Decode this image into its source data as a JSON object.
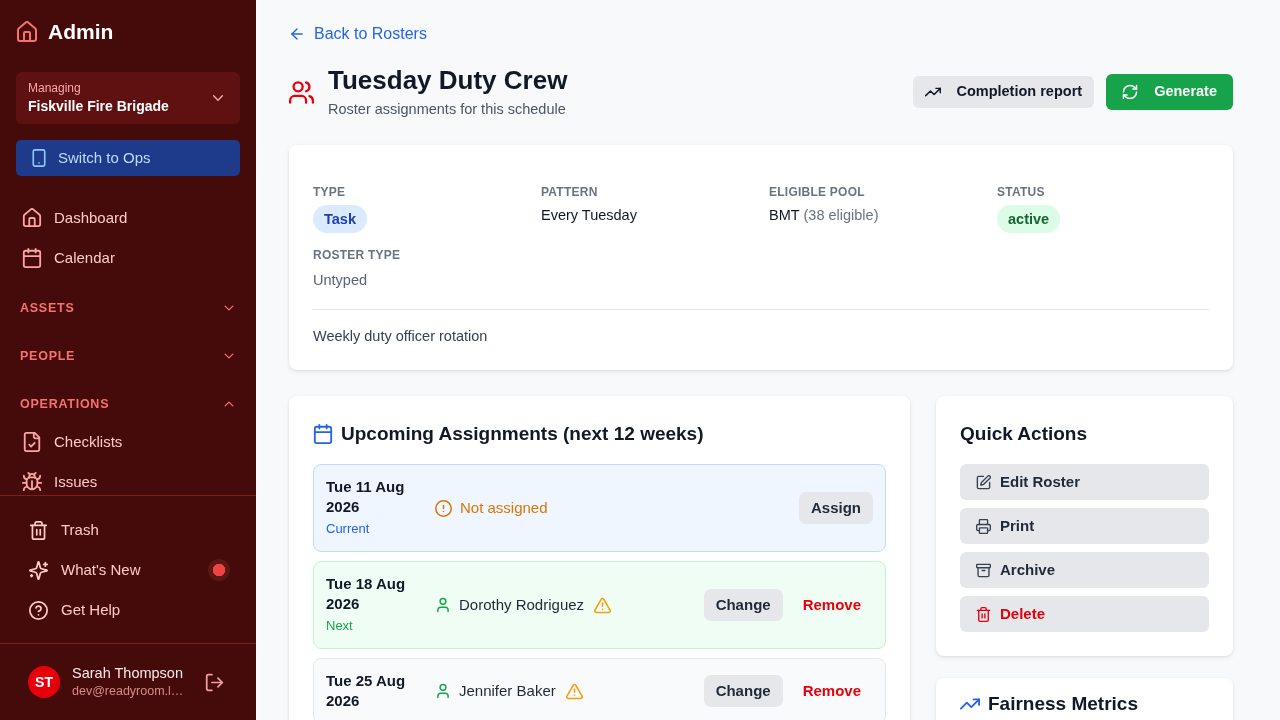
{
  "sidebar": {
    "brand": "Admin",
    "org_switcher": {
      "caption": "Managing",
      "name": "Fiskville Fire Brigade"
    },
    "mode_button": "Switch to Ops",
    "nav": [
      {
        "kind": "link",
        "label": "Dashboard",
        "selected": false
      },
      {
        "kind": "link",
        "label": "Calendar",
        "selected": false
      },
      {
        "kind": "section",
        "label": "ASSETS",
        "expanded": false
      },
      {
        "kind": "section",
        "label": "PEOPLE",
        "expanded": false
      },
      {
        "kind": "section",
        "label": "OPERATIONS",
        "expanded": true,
        "children": [
          {
            "kind": "link",
            "label": "Checklists",
            "selected": false
          },
          {
            "kind": "link",
            "label": "Issues",
            "selected": false
          }
        ]
      }
    ],
    "footer_links": [
      {
        "label": "Trash",
        "unread": false
      },
      {
        "label": "What's New",
        "unread": true
      },
      {
        "label": "Get Help",
        "unread": false
      }
    ],
    "user": {
      "initials": "ST",
      "name": "Sarah Thompson",
      "email": "dev@readyroom.l…"
    }
  },
  "back_link": "Back to Rosters",
  "header": {
    "title": "Tuesday Duty Crew",
    "subtitle": "Roster assignments for this schedule",
    "actions": [
      {
        "label": "Completion report",
        "kind": "secondary"
      },
      {
        "label": "Generate",
        "kind": "primary"
      }
    ]
  },
  "details": {
    "fields": [
      {
        "label": "TYPE",
        "kind": "badge",
        "value": "Task",
        "color": "#dbeafe"
      },
      {
        "label": "PATTERN",
        "kind": "text",
        "value": "Every Tuesday"
      },
      {
        "label": "ELIGIBLE POOL",
        "kind": "text",
        "value": "BMT",
        "note": "(38 eligible)"
      },
      {
        "label": "STATUS",
        "kind": "badge",
        "value": "active",
        "color": "#dcfce7"
      },
      {
        "label": "ROSTER TYPE",
        "kind": "muted",
        "value": "Untyped"
      }
    ],
    "description": "Weekly duty officer rotation"
  },
  "assignments": {
    "title": "Upcoming Assignments (next 12 weeks)",
    "rows": [
      {
        "kind": "current",
        "date": "Tue 11 Aug 2026",
        "tag": "Current",
        "assignee": {
          "kind": "unassigned",
          "text": "Not assigned",
          "warning": false
        },
        "actions": [
          {
            "label": "Assign",
            "kind": "secondary"
          }
        ]
      },
      {
        "kind": "next",
        "date": "Tue 18 Aug 2026",
        "tag": "Next",
        "assignee": {
          "kind": "person",
          "text": "Dorothy Rodriguez",
          "warning": true
        },
        "actions": [
          {
            "label": "Change",
            "kind": "secondary"
          },
          {
            "label": "Remove",
            "kind": "danger"
          }
        ]
      },
      {
        "kind": "upcoming",
        "date": "Tue 25 Aug 2026",
        "assignee": {
          "kind": "person",
          "text": "Jennifer Baker",
          "warning": true
        },
        "actions": [
          {
            "label": "Change",
            "kind": "secondary"
          },
          {
            "label": "Remove",
            "kind": "danger"
          }
        ]
      }
    ]
  },
  "quick_actions": {
    "title": "Quick Actions",
    "actions": [
      {
        "label": "Edit Roster",
        "kind": "default"
      },
      {
        "label": "Print",
        "kind": "default"
      },
      {
        "label": "Archive",
        "kind": "default"
      },
      {
        "label": "Delete",
        "kind": "danger"
      }
    ]
  },
  "fairness": {
    "title": "Fairness Metrics"
  }
}
